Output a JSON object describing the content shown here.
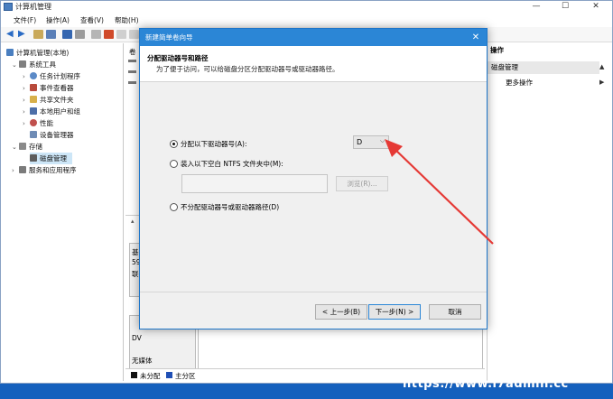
{
  "window": {
    "title": "计算机管理",
    "controls": [
      "—",
      "☐",
      "✕"
    ]
  },
  "menu": [
    "文件(F)",
    "操作(A)",
    "查看(V)",
    "帮助(H)"
  ],
  "tree": {
    "root": "计算机管理(本地)",
    "system_tools": "系统工具",
    "task_scheduler": "任务计划程序",
    "event_viewer": "事件查看器",
    "shared_folders": "共享文件夹",
    "local_users": "本地用户和组",
    "performance": "性能",
    "device_manager": "设备管理器",
    "storage": "存储",
    "disk_management": "磁盘管理",
    "services": "服务和应用程序"
  },
  "mid": {
    "col_header": "卷",
    "disk_label_1": "基",
    "disk_size_1": "59",
    "disk_status_1": "联",
    "dvd_label": "DV",
    "no_media": "无媒体",
    "legend": {
      "unallocated": "未分配",
      "primary": "主分区",
      "unallocated_color": "#111111",
      "primary_color": "#1f4fb5"
    }
  },
  "actions": {
    "header": "操作",
    "section": "磁盘管理",
    "more": "更多操作"
  },
  "dialog": {
    "title": "新建简单卷向导",
    "heading": "分配驱动器号和路径",
    "subheading": "为了便于访问，可以给磁盘分区分配驱动器号或驱动器路径。",
    "options": {
      "assign_letter": "分配以下驱动器号(A):",
      "mount_folder": "装入以下空白 NTFS 文件夹中(M):",
      "no_assign": "不分配驱动器号或驱动器路径(D)"
    },
    "selected_letter": "D",
    "browse": "浏览(R)...",
    "buttons": {
      "back": "< 上一步(B)",
      "next": "下一步(N) >",
      "cancel": "取消"
    }
  },
  "watermark": "https://www.i7admin.cc",
  "colors": {
    "accent": "#2b86d6",
    "arrow": "#e53935",
    "desktop": "#1e6fd0"
  }
}
